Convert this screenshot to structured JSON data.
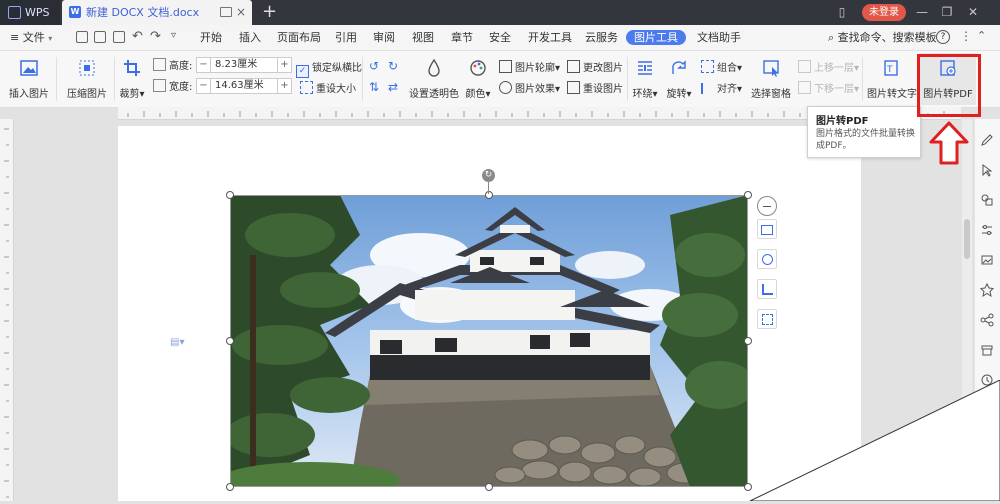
{
  "titlebar": {
    "app_name": "WPS",
    "document_tab": "新建 DOCX 文档.docx",
    "login_button": "未登录"
  },
  "menubar": {
    "file_label": "文件",
    "items": [
      "开始",
      "插入",
      "页面布局",
      "引用",
      "审阅",
      "视图",
      "章节",
      "安全",
      "开发工具",
      "云服务",
      "图片工具",
      "文档助手"
    ],
    "active_item": "图片工具",
    "search_label": "查找命令、搜索模板"
  },
  "ribbon": {
    "insert_image": "插入图片",
    "compress_image": "压缩图片",
    "crop": "裁剪",
    "height_label": "高度:",
    "height_value": "8.23厘米",
    "width_label": "宽度:",
    "width_value": "14.63厘米",
    "lock_ratio": "锁定纵横比",
    "reset_size": "重设大小",
    "set_transparent": "设置透明色",
    "color": "颜色",
    "image_outline": "图片轮廓",
    "image_effect": "图片效果",
    "change_image": "更改图片",
    "reset_image": "重设图片",
    "wrap": "环绕",
    "rotate": "旋转",
    "group": "组合",
    "align": "对齐",
    "selection_pane": "选择窗格",
    "bring_forward": "上移一层",
    "send_backward": "下移一层",
    "image_to_text": "图片转文字",
    "image_to_pdf": "图片转PDF"
  },
  "tooltip": {
    "title": "图片转PDF",
    "description": "图片格式的文件批量转换成PDF。"
  },
  "colors": {
    "accent": "#4b7bec",
    "highlight": "#e02020",
    "login": "#e25848",
    "titlebar": "#33363d"
  }
}
